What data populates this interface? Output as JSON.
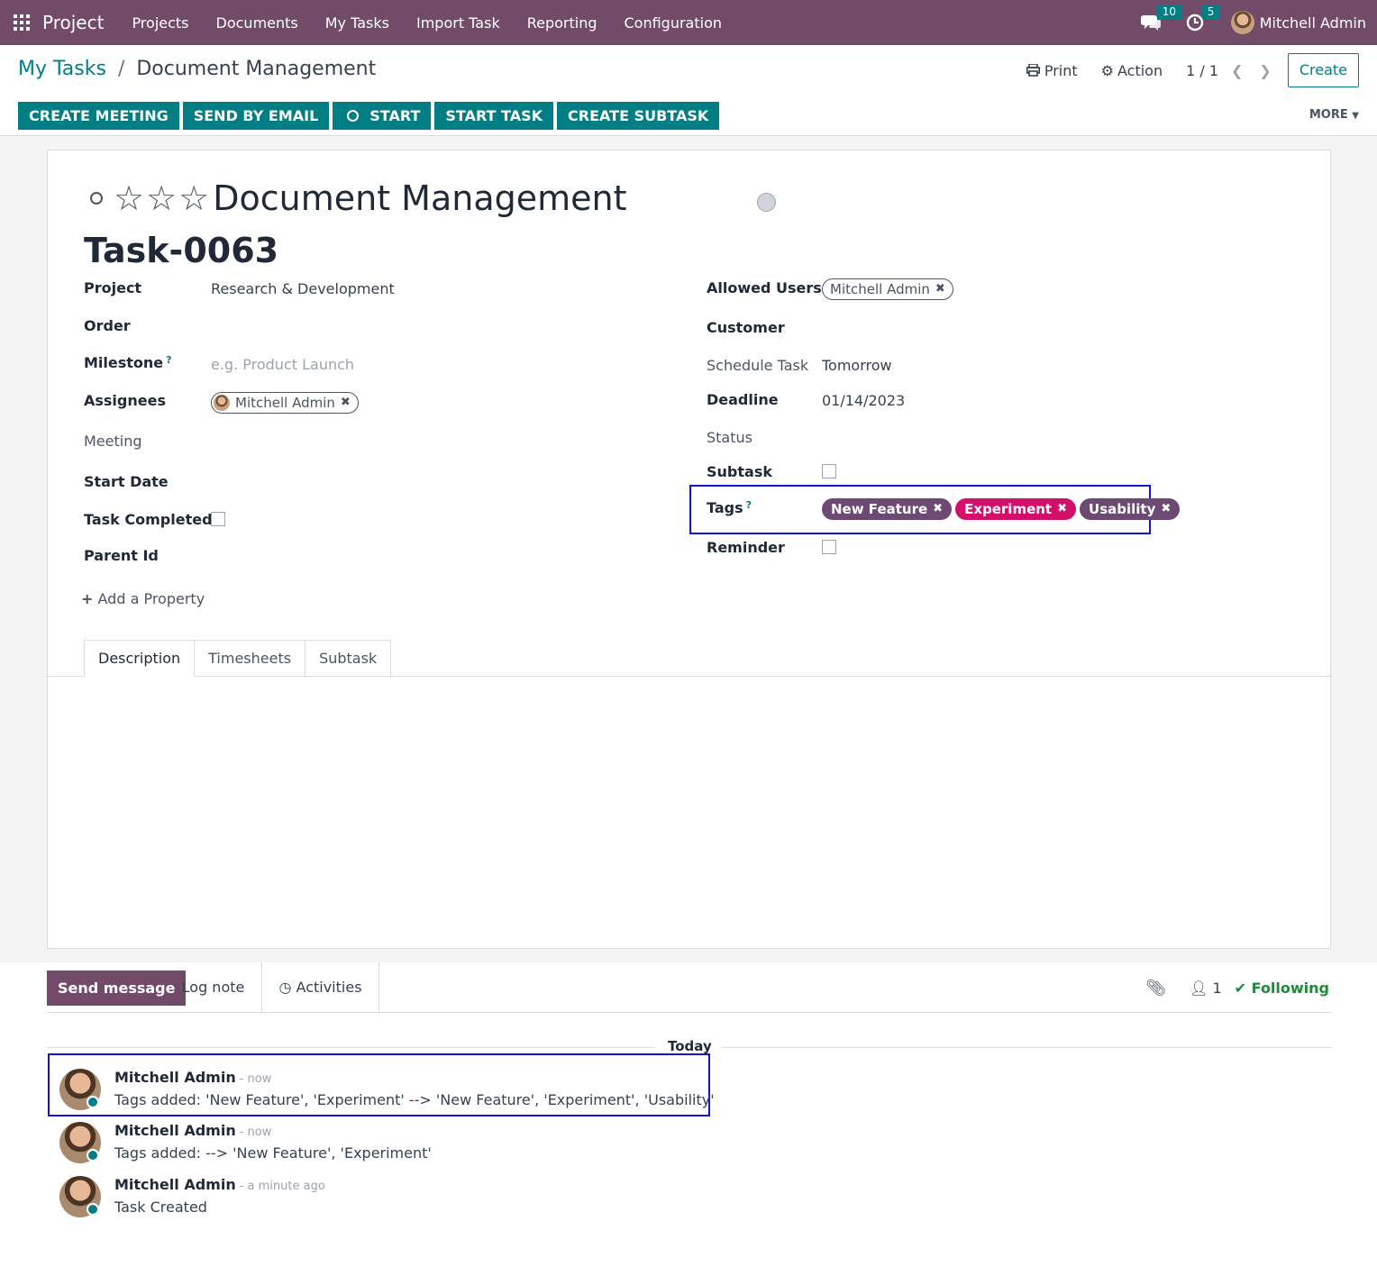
{
  "navbar": {
    "brand": "Project",
    "menu": [
      "Projects",
      "Documents",
      "My Tasks",
      "Import Task",
      "Reporting",
      "Configuration"
    ],
    "messages_count": "10",
    "activities_count": "5",
    "user": "Mitchell Admin",
    "bg_color": "#714B67"
  },
  "breadcrumb": {
    "parent": "My Tasks",
    "separator": "/",
    "current": "Document Management"
  },
  "control": {
    "print": "Print",
    "action": "Action",
    "pager": "1 / 1",
    "create": "Create",
    "more": "MORE"
  },
  "action_buttons": [
    "CREATE MEETING",
    "SEND BY EMAIL",
    "START",
    "START TASK",
    "CREATE SUBTASK"
  ],
  "task": {
    "name": "Document Management",
    "code": "Task-0063",
    "stars": 3
  },
  "left_fields": {
    "project_label": "Project",
    "project_value": "Research & Development",
    "order_label": "Order",
    "milestone_label": "Milestone",
    "milestone_help": "?",
    "milestone_placeholder": "e.g. Product Launch",
    "assignees_label": "Assignees",
    "assignee": "Mitchell Admin",
    "meeting_label": "Meeting",
    "start_date_label": "Start Date",
    "task_completed_label": "Task Completed",
    "parent_id_label": "Parent Id",
    "add_property": "Add a Property"
  },
  "right_fields": {
    "allowed_users_label": "Allowed Users",
    "allowed_user": "Mitchell Admin",
    "customer_label": "Customer",
    "schedule_task_label": "Schedule Task",
    "schedule_task_value": "Tomorrow",
    "deadline_label": "Deadline",
    "deadline_value": "01/14/2023",
    "status_label": "Status",
    "subtask_label": "Subtask",
    "tags_label": "Tags",
    "tags_help": "?",
    "tags": [
      {
        "name": "New Feature",
        "color": "#6C4A74"
      },
      {
        "name": "Experiment",
        "color": "#D40F6B"
      },
      {
        "name": "Usability",
        "color": "#6C4A74"
      }
    ],
    "reminder_label": "Reminder"
  },
  "tabs": [
    "Description",
    "Timesheets",
    "Subtask"
  ],
  "chatter": {
    "send_message": "Send message",
    "log_note": "Log note",
    "activities": "Activities",
    "followers_count": "1",
    "following": "Following",
    "today": "Today",
    "messages": [
      {
        "author": "Mitchell Admin",
        "date": "- now",
        "body": "Tags added: 'New Feature', 'Experiment' --> 'New Feature', 'Experiment', 'Usability'"
      },
      {
        "author": "Mitchell Admin",
        "date": "- now",
        "body": "Tags added: --> 'New Feature', 'Experiment'"
      },
      {
        "author": "Mitchell Admin",
        "date": "- a minute ago",
        "body": "Task Created"
      }
    ]
  }
}
